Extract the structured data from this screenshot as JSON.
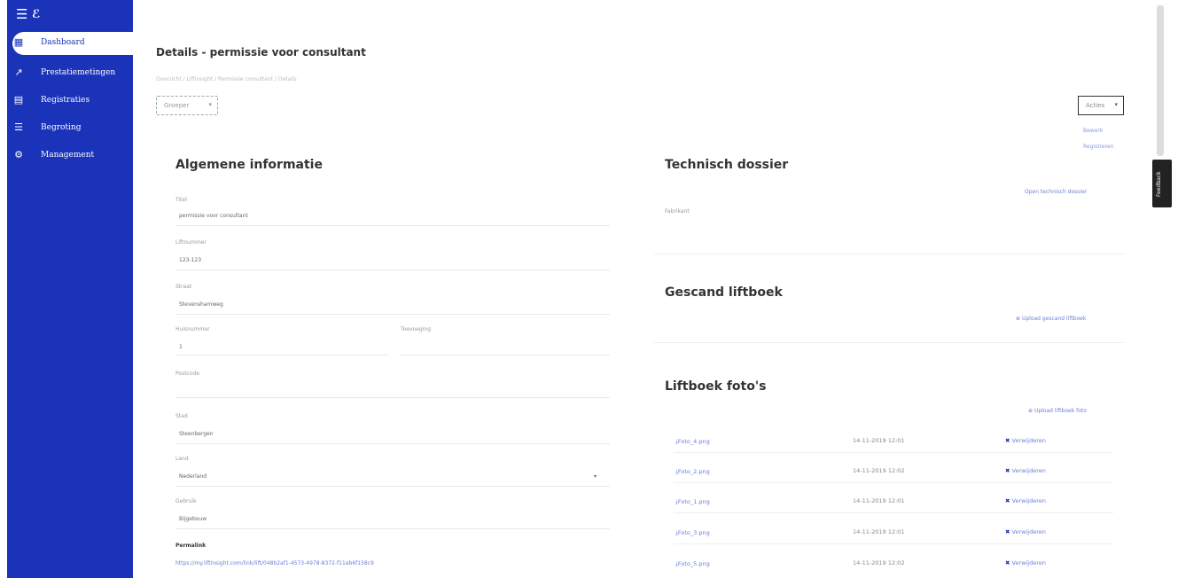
{
  "app": {
    "logo_text": "ℰ"
  },
  "sidebar": {
    "items": [
      {
        "label": "Dashboard",
        "icon": "dashboard-icon",
        "glyph": "▦",
        "active": true
      },
      {
        "label": "Prestatiemetingen",
        "icon": "chart-icon",
        "glyph": "↗",
        "active": false
      },
      {
        "label": "Registraties",
        "icon": "clipboard-icon",
        "glyph": "▤",
        "active": false
      },
      {
        "label": "Begroting",
        "icon": "database-icon",
        "glyph": "☰",
        "active": false
      },
      {
        "label": "Management",
        "icon": "gear-icon",
        "glyph": "⚙",
        "active": false
      }
    ]
  },
  "header": {
    "title": "Details - permissie voor consultant",
    "breadcrumb": "Overzicht  /  Liftinsight  /  Permissie consultant  /  Details",
    "group_select": "Groeper",
    "actions_button": "Acties",
    "actions_menu": [
      "Bewerk",
      "Registreren"
    ],
    "feedback": "Feedback"
  },
  "algemene": {
    "title": "Algemene informatie",
    "fields": [
      {
        "label": "Titel",
        "value": "permissie voor consultant"
      },
      {
        "label": "Liftnummer",
        "value": "123-123"
      },
      {
        "label": "Straat",
        "value": "Stevenshamweg"
      },
      {
        "label": "Huisnummer",
        "value": "1"
      },
      {
        "label": "Toevoeging",
        "value": ""
      },
      {
        "label": "Postcode",
        "value": ""
      },
      {
        "label": "Stad",
        "value": "Steenbergen"
      },
      {
        "label": "Land",
        "value": "Nederland"
      },
      {
        "label": "Gebruik",
        "value": "Bijgebouw"
      }
    ],
    "permalink_label": "Permalink",
    "permalink_url": "https://my.liftinsight.com/link/lift/048b2af1-4573-4978-8372-f11eb6f158c9"
  },
  "technisch": {
    "title": "Technisch dossier",
    "link": "Open technisch dossier",
    "field_label": "Fabrikant"
  },
  "gescand": {
    "title": "Gescand liftboek",
    "upload_link": "Upload gescand liftboek"
  },
  "fotos": {
    "title": "Liftboek foto's",
    "upload_link": "Upload liftboek foto",
    "rows": [
      {
        "file": "Foto_4.png",
        "date": "14-11-2019 12:01",
        "action": "Verwijderen"
      },
      {
        "file": "Foto_2.png",
        "date": "14-11-2019 12:02",
        "action": "Verwijderen"
      },
      {
        "file": "Foto_1.png",
        "date": "14-11-2019 12:01",
        "action": "Verwijderen"
      },
      {
        "file": "Foto_3.png",
        "date": "14-11-2019 12:01",
        "action": "Verwijderen"
      },
      {
        "file": "Foto_5.png",
        "date": "14-11-2019 12:02",
        "action": "Verwijderen"
      }
    ]
  },
  "colors": {
    "sidebar": "#1a33b8",
    "link": "#6b7fd6"
  }
}
